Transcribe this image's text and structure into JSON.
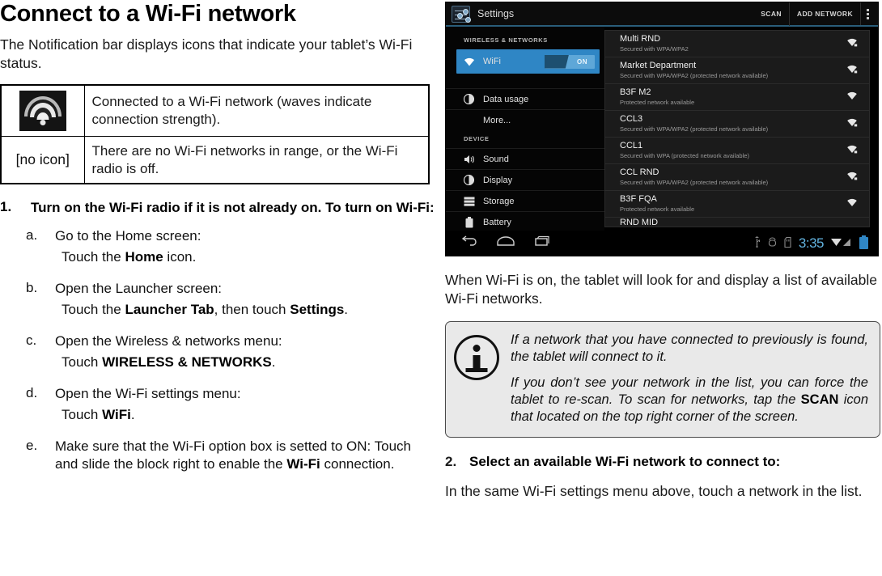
{
  "left": {
    "title": "Connect to a Wi-Fi network",
    "intro": "The Notification bar displays icons that indicate your tablet’s Wi-Fi status.",
    "icon_table": {
      "rows": [
        {
          "icon": "wifi-signal-icon",
          "icon_label": "",
          "desc": "Connected to a Wi-Fi network (waves indicate connection strength)."
        },
        {
          "icon": "none",
          "icon_label": "[no icon]",
          "desc": "There are no Wi-Fi networks in range, or the Wi-Fi radio is off."
        }
      ]
    },
    "step1": {
      "number": "1.",
      "text": "Turn on the Wi-Fi radio if it is not already on. To turn on Wi-Fi:"
    },
    "substeps": [
      {
        "letter": "a.",
        "line1": "Go to the Home screen:",
        "line2_pre": "Touch the ",
        "line2_bold": "Home",
        "line2_post": " icon."
      },
      {
        "letter": "b.",
        "line1": "Open the Launcher screen:",
        "line2_pre": "Touch the ",
        "line2_bold": "Launcher Tab",
        "line2_post": ", then touch ",
        "line2_bold2": "Settings",
        "line2_post2": "."
      },
      {
        "letter": "c.",
        "line1": "Open the Wireless & networks menu:",
        "line2_pre": "Touch ",
        "line2_bold": "WIRELESS & NETWORKS",
        "line2_post": "."
      },
      {
        "letter": "d.",
        "line1": "Open the Wi-Fi settings menu:",
        "line2_pre": "Touch ",
        "line2_bold": "WiFi",
        "line2_post": "."
      },
      {
        "letter": "e.",
        "line1": "Make sure that the Wi-Fi option box is setted to ON:  Touch and slide the block right to enable the ",
        "line1_bold": "Wi-Fi",
        "line1_post": " connection.",
        "line2_pre": "",
        "line2_bold": "",
        "line2_post": ""
      }
    ]
  },
  "tablet": {
    "app_title": "Settings",
    "header_actions": {
      "scan": "SCAN",
      "add_network": "ADD NETWORK"
    },
    "sidebar": {
      "section_wireless": "WIRELESS & NETWORKS",
      "section_device": "DEVICE",
      "items": [
        {
          "label": "WiFi",
          "icon": "wifi-icon",
          "toggle": "ON",
          "active": true
        },
        {
          "label": "Data usage",
          "icon": "pie-chart-icon",
          "active": false
        },
        {
          "label": "More...",
          "icon": "none",
          "active": false
        },
        {
          "label": "Sound",
          "icon": "speaker-icon",
          "active": false
        },
        {
          "label": "Display",
          "icon": "brightness-icon",
          "active": false
        },
        {
          "label": "Storage",
          "icon": "storage-icon",
          "active": false
        },
        {
          "label": "Battery",
          "icon": "battery-icon",
          "active": false
        }
      ]
    },
    "networks": [
      {
        "name": "Multi RND",
        "security": "Secured with WPA/WPA2",
        "signal": "wifi-secured-icon"
      },
      {
        "name": "Market Department",
        "security": "Secured with WPA/WPA2 (protected network available)",
        "signal": "wifi-secured-icon"
      },
      {
        "name": "B3F M2",
        "security": "Protected network available",
        "signal": "wifi-open-icon"
      },
      {
        "name": "CCL3",
        "security": "Secured with WPA/WPA2 (protected network available)",
        "signal": "wifi-secured-icon"
      },
      {
        "name": "CCL1",
        "security": "Secured with WPA (protected network available)",
        "signal": "wifi-secured-icon"
      },
      {
        "name": "CCL RND",
        "security": "Secured with WPA/WPA2 (protected network available)",
        "signal": "wifi-secured-icon"
      },
      {
        "name": "B3F FQA",
        "security": "Protected network available",
        "signal": "wifi-open-icon"
      },
      {
        "name": "RND MID",
        "security": "",
        "signal": ""
      }
    ],
    "navbar": {
      "back": "back-icon",
      "home": "home-icon",
      "recents": "recents-icon"
    },
    "statusbar": {
      "usb": "usb-icon",
      "debug": "android-debug-icon",
      "sd": "sd-card-icon",
      "time": "3:35",
      "signal": "signal-icon",
      "battery": "battery-charging-icon"
    }
  },
  "right": {
    "para1": "When Wi-Fi is on, the tablet will look for and display a list of available Wi-Fi networks.",
    "info": {
      "icon": "information-icon",
      "p1": "If a network that you have connected to previously is found, the tablet will connect to it.",
      "p2_pre": "If you don’t see your network in the list, you can force the tablet to re-scan. To scan for networks, tap the ",
      "p2_bold": "SCAN",
      "p2_post": " icon that located on the top right corner of the screen."
    },
    "step2": {
      "number": "2.",
      "text": "Select an available Wi-Fi network to connect to:"
    },
    "closing": "In the same Wi-Fi settings menu above, touch a network in the list."
  }
}
